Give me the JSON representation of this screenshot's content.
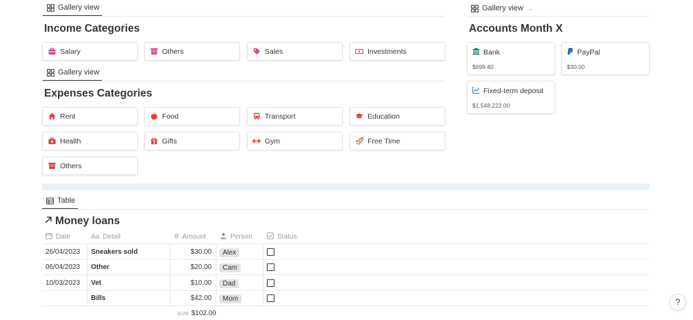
{
  "income": {
    "view_label": "Gallery view",
    "title": "Income Categories",
    "cards": [
      {
        "label": "Salary",
        "icon": "briefcase-icon",
        "color": "#d44c8e"
      },
      {
        "label": "Others",
        "icon": "archive-icon",
        "color": "#d44c8e"
      },
      {
        "label": "Sales",
        "icon": "tag-icon",
        "color": "#d44c8e"
      },
      {
        "label": "Investments",
        "icon": "money-icon",
        "color": "#d44c8e"
      }
    ]
  },
  "expenses": {
    "view_label": "Gallery view",
    "title": "Expenses Categories",
    "cards": [
      {
        "label": "Rent",
        "icon": "house-icon",
        "color": "#e03e3e"
      },
      {
        "label": "Food",
        "icon": "apple-icon",
        "color": "#e03e3e"
      },
      {
        "label": "Transport",
        "icon": "bus-icon",
        "color": "#e03e3e"
      },
      {
        "label": "Education",
        "icon": "graduation-cap-icon",
        "color": "#e03e3e"
      },
      {
        "label": "Health",
        "icon": "medkit-icon",
        "color": "#e03e3e"
      },
      {
        "label": "Gifts",
        "icon": "gift-icon",
        "color": "#e03e3e"
      },
      {
        "label": "Gym",
        "icon": "dumbbell-icon",
        "color": "#e03e3e"
      },
      {
        "label": "Free Time",
        "icon": "rocket-icon",
        "color": "#e03e3e"
      },
      {
        "label": "Others",
        "icon": "archive-icon",
        "color": "#e03e3e"
      }
    ]
  },
  "accounts": {
    "view_label": "Gallery view",
    "title": "Accounts Month X",
    "cards": [
      {
        "label": "Bank",
        "value": "$699.40",
        "icon": "bank-icon",
        "color": "#0f7b6c"
      },
      {
        "label": "PayPal",
        "value": "$30.00",
        "icon": "paypal-icon",
        "color": "#0b4fa0"
      },
      {
        "label": "Fixed-term deposit",
        "value": "$1,548,222.00",
        "icon": "chart-line-icon",
        "color": "#2e7cd1"
      }
    ]
  },
  "loans": {
    "view_label": "Table",
    "title": "Money loans",
    "columns": {
      "date": "Date",
      "detail": "Detail",
      "amount": "Amount",
      "person": "Person",
      "status": "Status"
    },
    "rows": [
      {
        "date": "26/04/2023",
        "detail": "Sneakers sold",
        "amount": "$30.00",
        "person": "Alex",
        "status": false
      },
      {
        "date": "06/04/2023",
        "detail": "Other",
        "amount": "$20.00",
        "person": "Cam",
        "status": false
      },
      {
        "date": "10/03/2023",
        "detail": "Vet",
        "amount": "$10.00",
        "person": "Dad",
        "status": false
      },
      {
        "date": "",
        "detail": "Bills",
        "amount": "$42.00",
        "person": "Mom",
        "status": false
      }
    ],
    "sum_label": "SUM",
    "sum_value": "$102.00"
  },
  "help": {
    "label": "?"
  }
}
